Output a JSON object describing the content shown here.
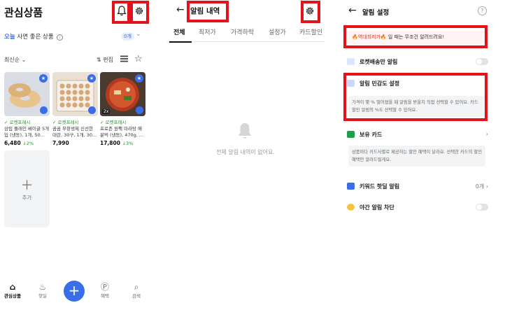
{
  "panel1": {
    "title": "관심상품",
    "daily_prefix": "오늘",
    "daily_rest": " 사면 좋은 상품",
    "daily_info": "i",
    "count": "0개",
    "sort": "최신순",
    "edit": "편집",
    "products": [
      {
        "rocket": "로켓프레시",
        "name": "삼립 플레인 베이글 5개입 (냉동), 1개, 50...",
        "price": "6,480",
        "pct": "↓2%",
        "bg": "#d9dde3",
        "twox": ""
      },
      {
        "rocket": "로켓프레시",
        "name": "곰곰 무항생제 신선한 대란, 30구, 1개, 30...",
        "price": "7,990",
        "pct": "",
        "bg": "#e9dfd3",
        "twox": ""
      },
      {
        "rocket": "로켓프레시",
        "name": "프로존 원팩 미라탕 애 분먹 (냉동), 470g, ...",
        "price": "17,800",
        "pct": "↓3%",
        "bg": "#4a3a30",
        "twox": "2x"
      }
    ],
    "add_label": "추가",
    "nav": [
      {
        "icon": "heart-house-icon",
        "label": "관심상품",
        "active": true
      },
      {
        "icon": "fire-icon",
        "label": "핫딜"
      },
      {
        "icon": "points-icon",
        "label": "혜택"
      },
      {
        "icon": "search-icon",
        "label": "검색"
      }
    ],
    "fab": "+"
  },
  "panel2": {
    "back": "←",
    "title": "알림 내역",
    "tabs": [
      "전체",
      "최저가",
      "가격하락",
      "설정가",
      "카드할인"
    ],
    "empty": "전체 알림 내역이 없어요."
  },
  "panel3": {
    "back": "←",
    "title": "알림 설정",
    "help": "?",
    "banner_hot": "🔥역대최저가🔥",
    "banner_rest": "일 때는 무조건 알려드려요!",
    "rocket_only": "로켓배송만 알림",
    "sensitivity": "알림 민감도 설정",
    "sensitivity_desc": "가격이 몇 % 떨어졌을 때 알림을 받을지 직접 선택할 수 있어요. 카드 할인 알림의 %도 선택할 수 있어요.",
    "owned_card": "보유 카드",
    "owned_card_desc": "상품마다 카드사별로 제공하는 할인 혜택이 달라요. 선택한 카드의 할인 혜택만 알려드릴게요.",
    "keyword": "키워드 핫딜 알림",
    "keyword_count": "0개",
    "night": "야간 알림 차단",
    "chevron": "›"
  },
  "colors": {
    "accent": "#3a6ee8",
    "highlight": "#e3121b",
    "rocket_green": "#2f8f2f"
  }
}
